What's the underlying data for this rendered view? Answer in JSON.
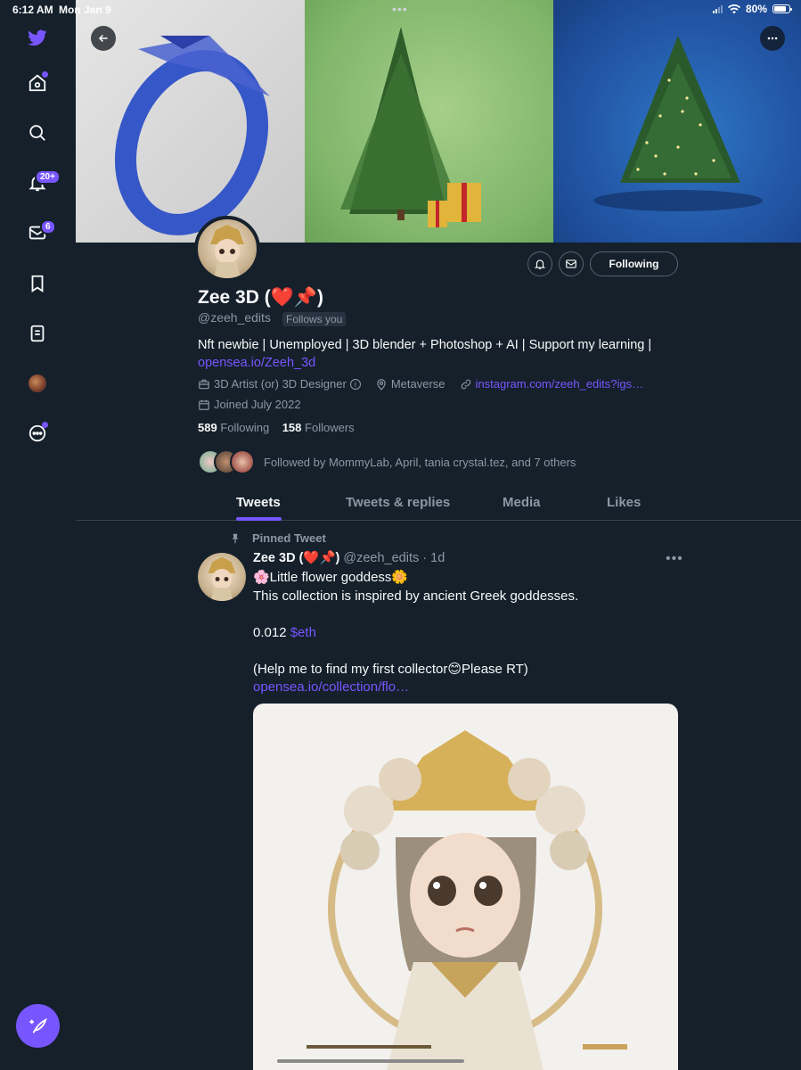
{
  "statusbar": {
    "time": "6:12 AM",
    "date": "Mon Jan 9",
    "battery": "80%",
    "battery_level": 0.8
  },
  "nav": {
    "notifications_badge": "20+",
    "messages_badge": "6"
  },
  "profile": {
    "name": "Zee 3D (❤️📌)",
    "handle": "@zeeh_edits",
    "follows_you": "Follows you",
    "following_button": "Following",
    "bio_text": "Nft newbie | Unemployed | 3D blender + Photoshop + AI | Support my learning | ",
    "bio_link": "opensea.io/Zeeh_3d",
    "category": "3D Artist (or) 3D Designer",
    "location": "Metaverse",
    "website": "instagram.com/zeeh_edits?igs…",
    "joined": "Joined July 2022",
    "following_count": "589",
    "following_label": "Following",
    "followers_count": "158",
    "followers_label": "Followers",
    "followed_by": "Followed by MommyLab, April, tania crystal.tez, and 7 others"
  },
  "tabs": [
    "Tweets",
    "Tweets & replies",
    "Media",
    "Likes"
  ],
  "tweet": {
    "pinned_label": "Pinned Tweet",
    "author": "Zee 3D (❤️📌)",
    "handle_time": "@zeeh_edits · 1d",
    "line1": "🌸Little flower goddess🌼",
    "line2": "This collection is inspired by ancient Greek goddesses.",
    "price_text": "0.012 ",
    "price_link": "$eth",
    "line4": "(Help me to find my first collector😊Please RT)",
    "link": "opensea.io/collection/flo…"
  },
  "colors": {
    "background": "#15202b",
    "accent": "#7856ff",
    "secondary_text": "#8b98a5",
    "border": "#38444d"
  }
}
